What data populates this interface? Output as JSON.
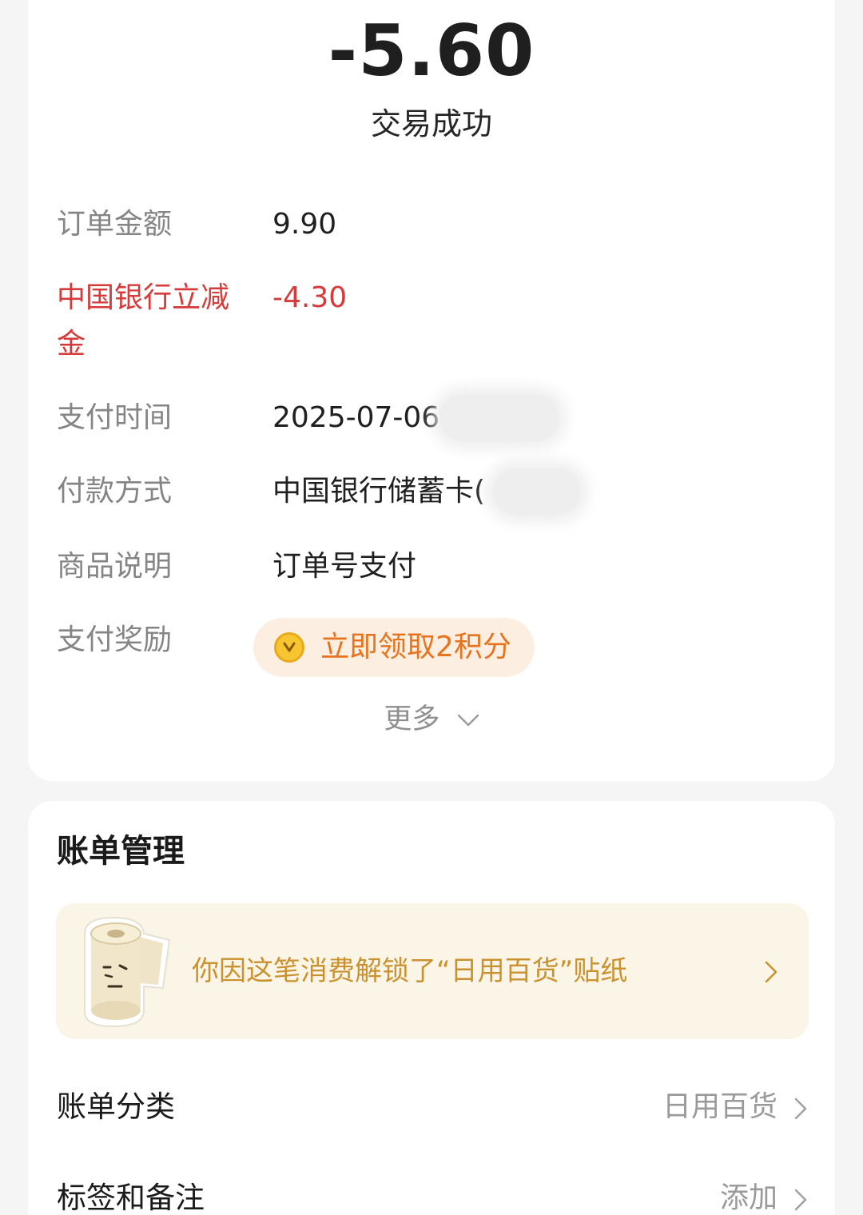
{
  "transaction": {
    "amount": "-5.60",
    "status": "交易成功"
  },
  "details": {
    "order_amount_label": "订单金额",
    "order_amount_value": "9.90",
    "discount_label_line1": "中国银行立减",
    "discount_label_line2": "金",
    "discount_value": "-4.30",
    "pay_time_label": "支付时间",
    "pay_time_value": "2025-07-06",
    "pay_method_label": "付款方式",
    "pay_method_value": "中国银行储蓄卡(",
    "product_label": "商品说明",
    "product_value": "订单号支付",
    "reward_label": "支付奖励",
    "reward_button": "立即领取2积分",
    "more_label": "更多"
  },
  "bill": {
    "title": "账单管理",
    "sticker_text": "你因这笔消费解锁了“日用百货”贴纸",
    "category_label": "账单分类",
    "category_value": "日用百货",
    "tags_label": "标签和备注",
    "tags_value": "添加"
  },
  "colors": {
    "accent_red": "#d63a3a",
    "reward_orange": "#e8731d",
    "sticker_gold": "#c9922e",
    "coin_yellow": "#f6c531"
  },
  "icons": {
    "coin": "coin-icon",
    "more": "chevron-down-icon",
    "row_arrow": "chevron-right-icon",
    "sticker": "toilet-roll-sticker-icon"
  }
}
